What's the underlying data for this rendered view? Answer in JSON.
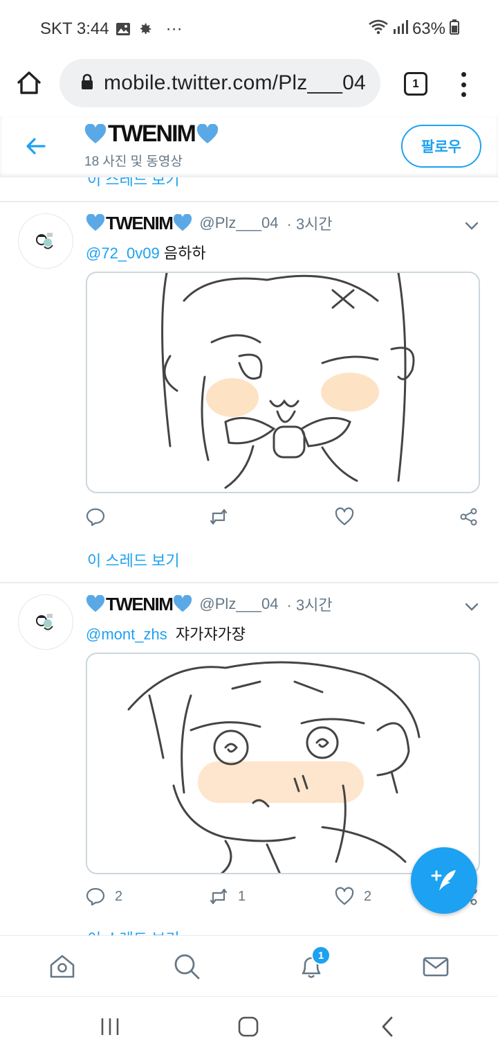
{
  "status_bar": {
    "carrier_time": "SKT 3:44",
    "more": "···",
    "battery": "63%"
  },
  "browser": {
    "url": "mobile.twitter.com/Plz___04",
    "tab_count": "1"
  },
  "profile": {
    "name": "TWENIM",
    "media_count": "18 사진 및 동영상",
    "follow_label": "팔로우"
  },
  "feed": {
    "top_thread_link": "이 스레드 보기",
    "tweets": [
      {
        "name": "TWENIM",
        "handle": "@Plz___04",
        "time": "· 3시간",
        "mention": "@72_0v09",
        "text": "음하하",
        "replies": "",
        "retweets": "",
        "likes": "",
        "thread_link": "이 스레드 보기"
      },
      {
        "name": "TWENIM",
        "handle": "@Plz___04",
        "time": "· 3시간",
        "mention": "@mont_zhs",
        "text": "쟈가쟈가쟝",
        "replies": "2",
        "retweets": "1",
        "likes": "2",
        "thread_link": "이 스레드 보기"
      }
    ]
  },
  "bottom_nav": {
    "notifications_badge": "1"
  },
  "colors": {
    "accent": "#1da1f2",
    "heart_emoji": "#5aa9e6",
    "secondary_text": "#657786",
    "divider": "#e6ecf0"
  },
  "icons": [
    "image-icon",
    "settings-icon",
    "wifi-icon",
    "signal-icon",
    "battery-icon",
    "home-icon",
    "lock-icon",
    "tabs-icon",
    "overflow-menu-icon",
    "back-arrow-icon",
    "blue-heart-icon",
    "chevron-down-icon",
    "reply-icon",
    "retweet-icon",
    "like-icon",
    "share-icon",
    "compose-icon",
    "search-icon",
    "bell-icon",
    "mail-icon",
    "recents-icon",
    "home-button-icon",
    "back-icon"
  ]
}
